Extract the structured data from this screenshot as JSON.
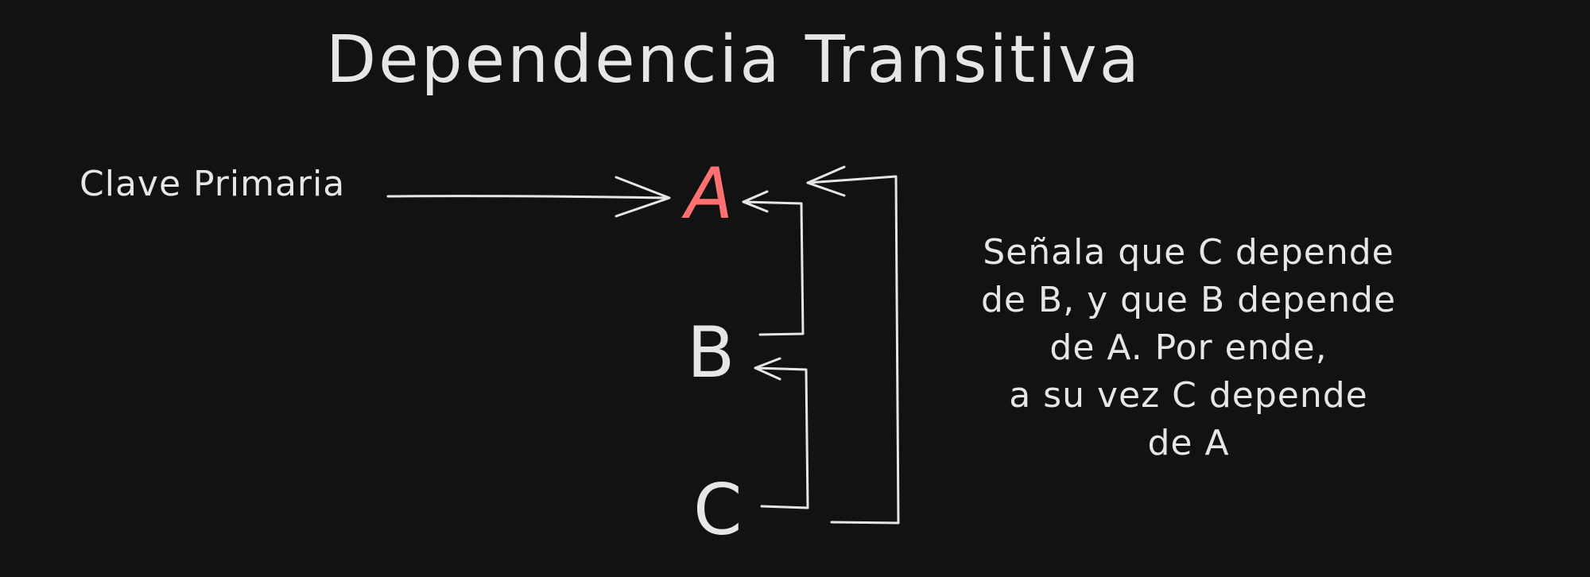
{
  "title": "Dependencia Transitiva",
  "primary_key_label": "Clave Primaria",
  "nodes": {
    "a": "A",
    "b": "B",
    "c": "C"
  },
  "note_lines": [
    "Señala que C depende",
    "de B, y que B depende",
    "de A. Por ende,",
    "a su vez C depende",
    "de A"
  ],
  "colors": {
    "background": "#121212",
    "stroke": "#e6e6e6",
    "highlight": "#ff7070"
  }
}
